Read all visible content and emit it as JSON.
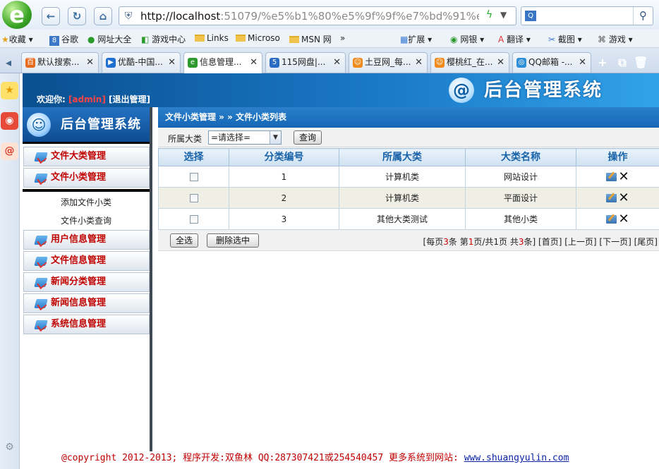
{
  "browser": {
    "logo": "e",
    "address": {
      "host": "http://localhost",
      "rest": ":51079/%e5%b1%80%e5%9f%9f%e7%bd%91%e6%"
    },
    "bookmarks": [
      "收藏",
      "谷歌",
      "网址大全",
      "游戏中心",
      "Links",
      "Microso",
      "MSN 网"
    ],
    "bookmarks_more": "»",
    "toolbar_right": [
      "扩展",
      "网银",
      "翻译",
      "截图",
      "游戏"
    ],
    "tabs": [
      {
        "label": "默认搜索...",
        "color": "#e66b1f",
        "glyph": "百"
      },
      {
        "label": "优酷-中国...",
        "color": "#1f6fd0",
        "glyph": "▶"
      },
      {
        "label": "信息管理...",
        "color": "#2e9a2e",
        "glyph": "e"
      },
      {
        "label": "115网盘|...",
        "color": "#2a6bc3",
        "glyph": "5"
      },
      {
        "label": "土豆网_每...",
        "color": "#f08a1a",
        "glyph": "☺"
      },
      {
        "label": "樱桃红_在...",
        "color": "#f08a1a",
        "glyph": "☺"
      },
      {
        "label": "QQ邮箱 -...",
        "color": "#2f8fd6",
        "glyph": "◎"
      }
    ],
    "tab_close": "✕",
    "active_tab": 2
  },
  "header": {
    "welcome": "欢迎你:",
    "user": "[admin]",
    "logout": "[退出管理]",
    "brand": "后台管理系统",
    "brand_icon": "@"
  },
  "sidebar": {
    "banner": "后台管理系统",
    "menu": [
      {
        "label": "文件大类管理"
      },
      {
        "label": "文件小类管理",
        "sub": [
          "添加文件小类",
          "文件小类查询"
        ]
      },
      {
        "label": "用户信息管理"
      },
      {
        "label": "文件信息管理"
      },
      {
        "label": "新闻分类管理"
      },
      {
        "label": "新闻信息管理"
      },
      {
        "label": "系统信息管理"
      }
    ]
  },
  "content": {
    "breadcrumb": "文件小类管理 » » 文件小类列表",
    "filter": {
      "label": "所属大类",
      "selected": "=请选择=",
      "query_button": "查询"
    },
    "table": {
      "headers": [
        "选择",
        "分类编号",
        "所属大类",
        "大类名称",
        "操作"
      ],
      "rows": [
        {
          "id": "1",
          "parent": "计算机类",
          "name": "网站设计"
        },
        {
          "id": "2",
          "parent": "计算机类",
          "name": "平面设计"
        },
        {
          "id": "3",
          "parent": "其他大类测试",
          "name": "其他小类"
        }
      ],
      "delete_glyph": "✕"
    },
    "actions": {
      "select_all": "全选",
      "delete_selected": "删除选中"
    },
    "pager": {
      "per_page_pre": "[每页",
      "per_page": "3",
      "per_page_post": "条 第",
      "current": "1",
      "of": "页/共",
      "total_pages": "1",
      "pages_total": "页 共",
      "total": "3",
      "total_post": "条]",
      "first": "[首页]",
      "prev": "[上一页]",
      "next": "[下一页]",
      "last": "[尾页]"
    }
  },
  "footer": {
    "text": "@copyright 2012-2013; 程序开发:双鱼林  QQ:287307421或254540457  更多系统到网站: ",
    "link": "www.shuangyulin.com"
  }
}
